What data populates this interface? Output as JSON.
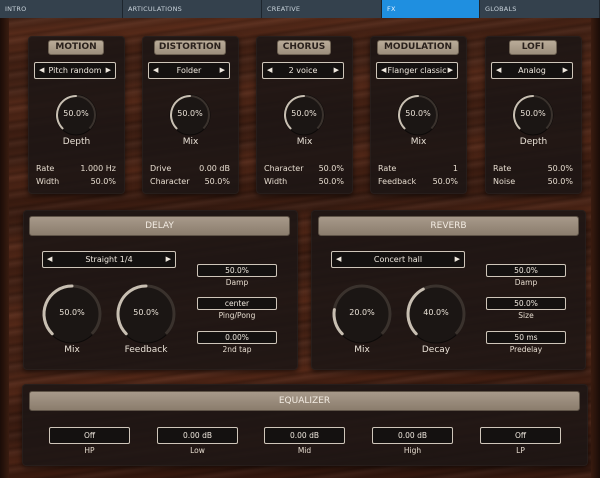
{
  "tabs": [
    {
      "label": "INTRO",
      "active": false
    },
    {
      "label": "ARTICULATIONS",
      "active": false
    },
    {
      "label": "CREATIVE",
      "active": false
    },
    {
      "label": "FX",
      "active": true
    },
    {
      "label": "GLOBALS",
      "active": false
    }
  ],
  "modules": {
    "motion": {
      "title": "MOTION",
      "selector": "Pitch random",
      "knob_value": "50.0%",
      "knob_label": "Depth",
      "params": [
        {
          "label": "Rate",
          "value": "1.000 Hz"
        },
        {
          "label": "Width",
          "value": "50.0%"
        }
      ]
    },
    "distortion": {
      "title": "DISTORTION",
      "selector": "Folder",
      "knob_value": "50.0%",
      "knob_label": "Mix",
      "params": [
        {
          "label": "Drive",
          "value": "0.00 dB"
        },
        {
          "label": "Character",
          "value": "50.0%"
        }
      ]
    },
    "chorus": {
      "title": "CHORUS",
      "selector": "2 voice",
      "knob_value": "50.0%",
      "knob_label": "Mix",
      "params": [
        {
          "label": "Character",
          "value": "50.0%"
        },
        {
          "label": "Width",
          "value": "50.0%"
        }
      ]
    },
    "modulation": {
      "title": "MODULATION",
      "selector": "Flanger classic",
      "knob_value": "50.0%",
      "knob_label": "Mix",
      "params": [
        {
          "label": "Rate",
          "value": "1"
        },
        {
          "label": "Feedback",
          "value": "50.0%"
        }
      ]
    },
    "lofi": {
      "title": "LOFI",
      "selector": "Analog",
      "knob_value": "50.0%",
      "knob_label": "Depth",
      "params": [
        {
          "label": "Rate",
          "value": "50.0%"
        },
        {
          "label": "Noise",
          "value": "50.0%"
        }
      ]
    }
  },
  "delay": {
    "title": "DELAY",
    "selector": "Straight 1/4",
    "mix_value": "50.0%",
    "mix_label": "Mix",
    "feedback_value": "50.0%",
    "feedback_label": "Feedback",
    "damp_value": "50.0%",
    "damp_label": "Damp",
    "pingpong_value": "center",
    "pingpong_label": "Ping/Pong",
    "tap_value": "0.00%",
    "tap_label": "2nd tap"
  },
  "reverb": {
    "title": "REVERB",
    "selector": "Concert hall",
    "mix_value": "20.0%",
    "mix_label": "Mix",
    "decay_value": "40.0%",
    "decay_label": "Decay",
    "damp_value": "50.0%",
    "damp_label": "Damp",
    "size_value": "50.0%",
    "size_label": "Size",
    "predelay_value": "50 ms",
    "predelay_label": "Predelay"
  },
  "equalizer": {
    "title": "EQUALIZER",
    "bands": [
      {
        "value": "Off",
        "label": "HP"
      },
      {
        "value": "0.00 dB",
        "label": "Low"
      },
      {
        "value": "0.00 dB",
        "label": "Mid"
      },
      {
        "value": "0.00 dB",
        "label": "High"
      },
      {
        "value": "Off",
        "label": "LP"
      }
    ]
  },
  "knob_levels": {
    "motion": 0.5,
    "distortion": 0.5,
    "chorus": 0.5,
    "modulation": 0.5,
    "lofi": 0.5,
    "delay_mix": 0.5,
    "delay_feedback": 0.5,
    "reverb_mix": 0.2,
    "reverb_decay": 0.4
  },
  "colors": {
    "tab_active": "#1f8fe0",
    "knob_arc": "#c8bfb2",
    "title_plate": "#a7998a"
  },
  "icons": {
    "selector_left": "triangle-left-icon",
    "selector_right": "triangle-right-icon"
  }
}
